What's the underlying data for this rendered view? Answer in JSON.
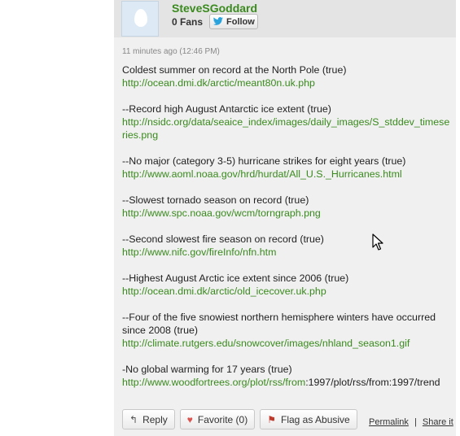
{
  "user": {
    "name": "SteveSGoddard",
    "fans": "0 Fans",
    "follow_label": "Follow"
  },
  "comment": {
    "timestamp": "11 minutes ago (12:46 PM)",
    "paragraphs": [
      {
        "text": "Coldest summer on record at the North Pole (true)",
        "link": "http://ocean.dmi.dk/arctic/meant80n.uk.php"
      },
      {
        "text": "--Record high August Antarctic ice extent (true)",
        "link": "http://nsidc.org/data/seaice_index/images/daily_images/S_stddev_timeseries.png"
      },
      {
        "text": "--No major (category 3-5) hurricane strikes for eight years (true)",
        "link": "http://www.aoml.noaa.gov/hrd/hurdat/All_U.S._Hurricanes.html"
      },
      {
        "text": "--Slowest tornado season on record (true)",
        "link": "http://www.spc.noaa.gov/wcm/torngraph.png"
      },
      {
        "text": "--Second slowest fire season on record (true)",
        "link": "http://www.nifc.gov/fireInfo/nfn.htm"
      },
      {
        "text": "--Highest August Arctic ice extent since 2006 (true)",
        "link": "http://ocean.dmi.dk/arctic/old_icecover.uk.php"
      },
      {
        "text": "--Four of the five snowiest northern hemisphere winters have occurred since 2008 (true)",
        "link": "http://climate.rutgers.edu/snowcover/images/nhland_season1.gif"
      },
      {
        "text": "-No global warming for 17 years (true)",
        "link": "http://www.woodfortrees.org/plot/rss/from",
        "link_tail": ":1997/plot/rss/from:1997/trend"
      }
    ]
  },
  "actions": {
    "reply": "Reply",
    "favorite": "Favorite (0)",
    "flag": "Flag as Abusive",
    "permalink": "Permalink",
    "separator": "|",
    "share": "Share it"
  },
  "colors": {
    "link": "#3a8a1e",
    "card_bg": "#f0f0f0",
    "header_bg": "#e4e4e4"
  },
  "icons": {
    "avatar": "egg-avatar-icon",
    "follow": "twitter-bird-icon",
    "reply": "reply-arrow-icon",
    "favorite": "heart-icon",
    "flag": "flag-icon",
    "cursor": "mouse-pointer-icon"
  }
}
